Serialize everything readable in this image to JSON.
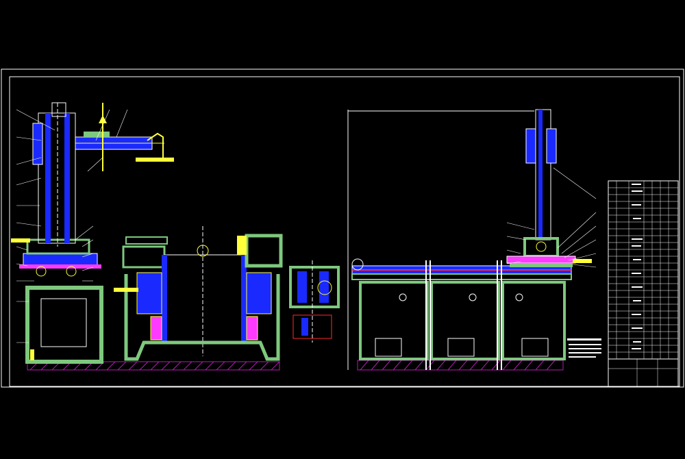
{
  "drawing": {
    "title_block_text": "",
    "colors": {
      "background": "#000000",
      "frame": "#ffffff",
      "structure_green": "#7ec87e",
      "section_blue": "#1a2aff",
      "yellow": "#ffff3a",
      "red": "#ff2a2a",
      "magenta": "#ff3aff",
      "cyan": "#3affff",
      "hatch": "#b01eb0"
    },
    "views": [
      "front-elevation",
      "drum-section",
      "gear-detail",
      "side-elevation"
    ]
  }
}
